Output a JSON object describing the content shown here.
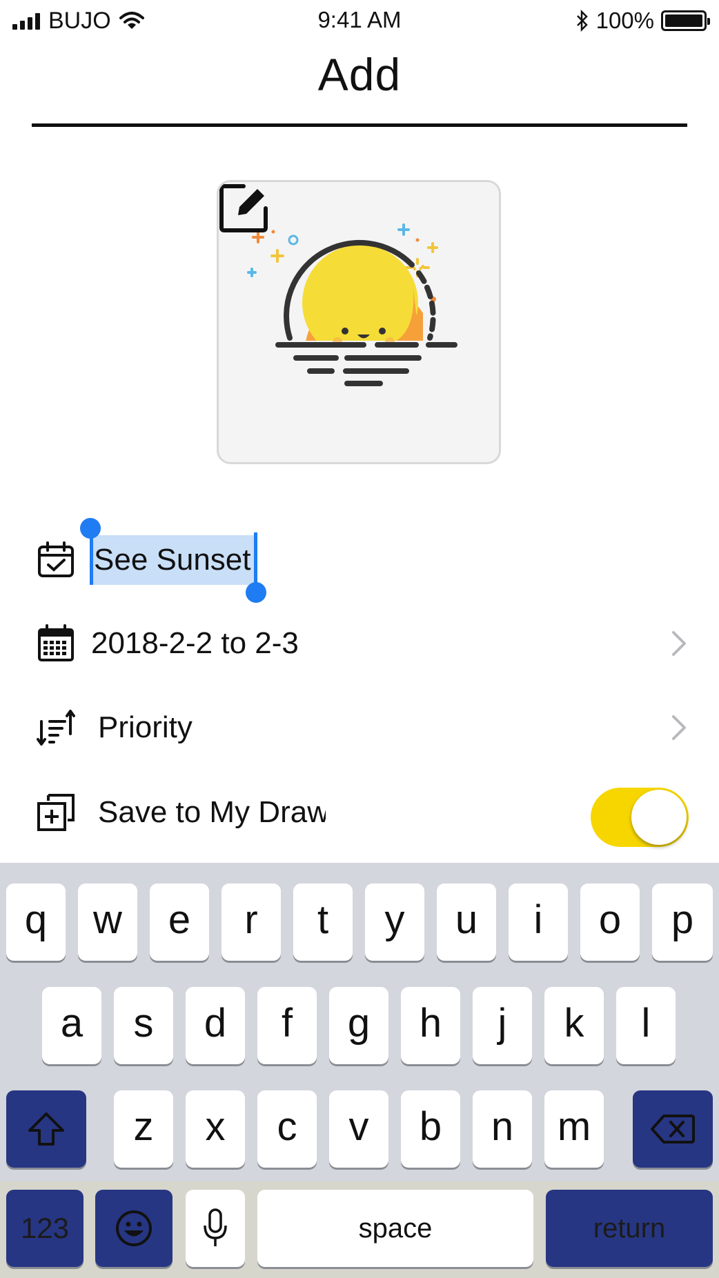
{
  "status_bar": {
    "carrier": "BUJO",
    "time": "9:41 AM",
    "battery": "100%",
    "icons": [
      "signal-icon",
      "wifi-icon",
      "bluetooth-icon",
      "battery-icon"
    ]
  },
  "header": {
    "title": "Add"
  },
  "image_card": {
    "icon": "sunset-emoji-illustration",
    "edit_icon": "edit-icon"
  },
  "form": {
    "name": {
      "value": "See Sunset",
      "icon": "calendar-check-icon"
    },
    "date": {
      "value": "2018-2-2 to 2-3",
      "icon": "calendar-grid-icon"
    },
    "priority": {
      "value": "Priority",
      "icon": "sort-priority-icon"
    },
    "save": {
      "value": "Save to My Draw",
      "icon": "add-to-drawer-icon",
      "toggle_on": true
    }
  },
  "keyboard": {
    "row1": [
      "q",
      "w",
      "e",
      "r",
      "t",
      "y",
      "u",
      "i",
      "o",
      "p"
    ],
    "row2": [
      "a",
      "s",
      "d",
      "f",
      "g",
      "h",
      "j",
      "k",
      "l"
    ],
    "row3": [
      "z",
      "x",
      "c",
      "v",
      "b",
      "n",
      "m"
    ],
    "numbers_label": "123",
    "space_label": "space",
    "return_label": "return",
    "icons": [
      "shift-icon",
      "backspace-icon",
      "emoji-icon",
      "microphone-icon"
    ]
  },
  "colors": {
    "accent_yellow": "#f7d600",
    "selection_blue": "#1f7cf2",
    "selection_fill": "#c9def7",
    "dark_key": "#273683"
  }
}
